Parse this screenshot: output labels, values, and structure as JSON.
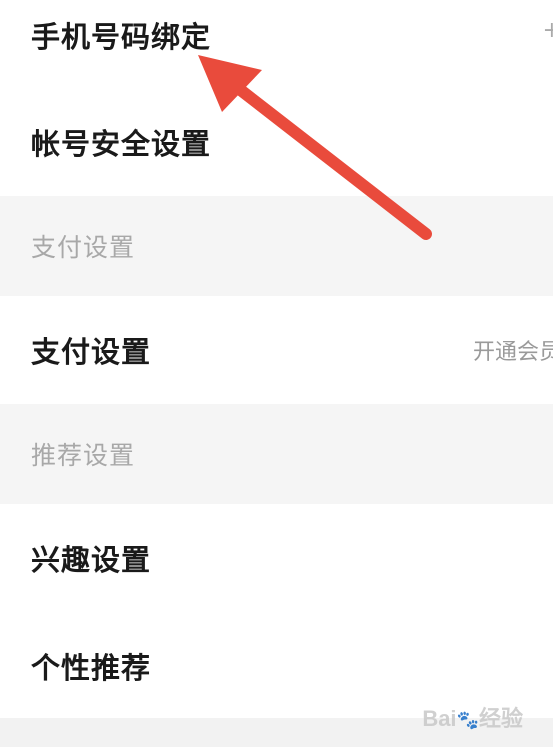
{
  "rows": {
    "phone_binding": {
      "label": "手机号码绑定",
      "value": "+"
    },
    "account_security": {
      "label": "帐号安全设置"
    },
    "payment": {
      "label": "支付设置",
      "value": "开通会员"
    },
    "interest": {
      "label": "兴趣设置"
    },
    "personal_recommend": {
      "label": "个性推荐"
    }
  },
  "sections": {
    "payment_header": "支付设置",
    "recommend_header": "推荐设置"
  },
  "annotation": {
    "arrow_color": "#e94b3c"
  },
  "watermark": {
    "brand": "Bai",
    "suffix": "经验"
  }
}
